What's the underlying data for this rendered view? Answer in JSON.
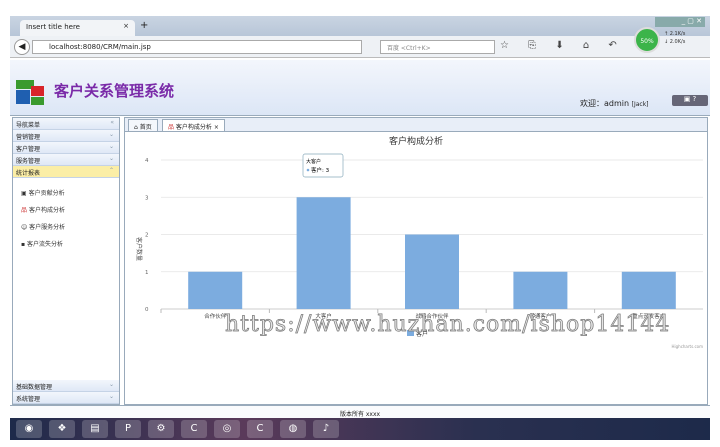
{
  "browser": {
    "tab_title": "Insert title here",
    "new_tab": "+",
    "close": "×",
    "url": "localhost:8080/CRM/main.jsp",
    "search_placeholder": "百度 <Ctrl+K>",
    "net_gauge": "50%",
    "upload": "↑ 2.1K/s",
    "download": "↓ 2.0K/s",
    "toolbar_icons": "☆ ⎘ ⬇ ⌂ ↶ ✉"
  },
  "header": {
    "title": "客户关系管理系统",
    "welcome": "欢迎：admin",
    "role": "[Jack]"
  },
  "sidebar": {
    "title": "导航菜单",
    "collapse": "«",
    "sections": [
      {
        "label": "营销管理",
        "chev": "⌄"
      },
      {
        "label": "客户管理",
        "chev": "⌄"
      },
      {
        "label": "服务管理",
        "chev": "⌄"
      },
      {
        "label": "统计报表",
        "chev": "⌃"
      }
    ],
    "items": [
      {
        "label": "客户贡献分析"
      },
      {
        "label": "客户构成分析"
      },
      {
        "label": "客户服务分析"
      },
      {
        "label": "客户流失分析"
      }
    ],
    "bottom": [
      {
        "label": "基础数据管理",
        "chev": "⌄"
      },
      {
        "label": "系统管理",
        "chev": "⌄"
      }
    ]
  },
  "tabs": [
    {
      "label": "首页"
    },
    {
      "label": "客户构成分析",
      "close": "×"
    }
  ],
  "chart_data": {
    "type": "bar",
    "title": "客户构成分析",
    "ylabel": "客户数量",
    "xlabel": "",
    "categories": [
      "合作伙伴",
      "大客户",
      "战略合作伙伴",
      "普通客户",
      "重点开发客户"
    ],
    "series": [
      {
        "name": "客户",
        "values": [
          1,
          3,
          2,
          1,
          1
        ]
      }
    ],
    "ylim": [
      0,
      4
    ],
    "yticks": [
      "0",
      "1",
      "2",
      "3",
      "4"
    ],
    "grid": true,
    "legend": "bottom",
    "color": "#7cacdf",
    "tooltip": {
      "title": "大客户",
      "text": "客户: 3"
    },
    "credits": "Highcharts.com"
  },
  "footer": {
    "text": "版本所有 xxxx"
  },
  "watermark": "https://www.huzhan.com/ishop14144",
  "taskbar": {
    "icons": [
      "start",
      "app",
      "files",
      "wps",
      "tool",
      "camtasia",
      "chrome",
      "camtasia2",
      "firefox",
      "media"
    ]
  }
}
